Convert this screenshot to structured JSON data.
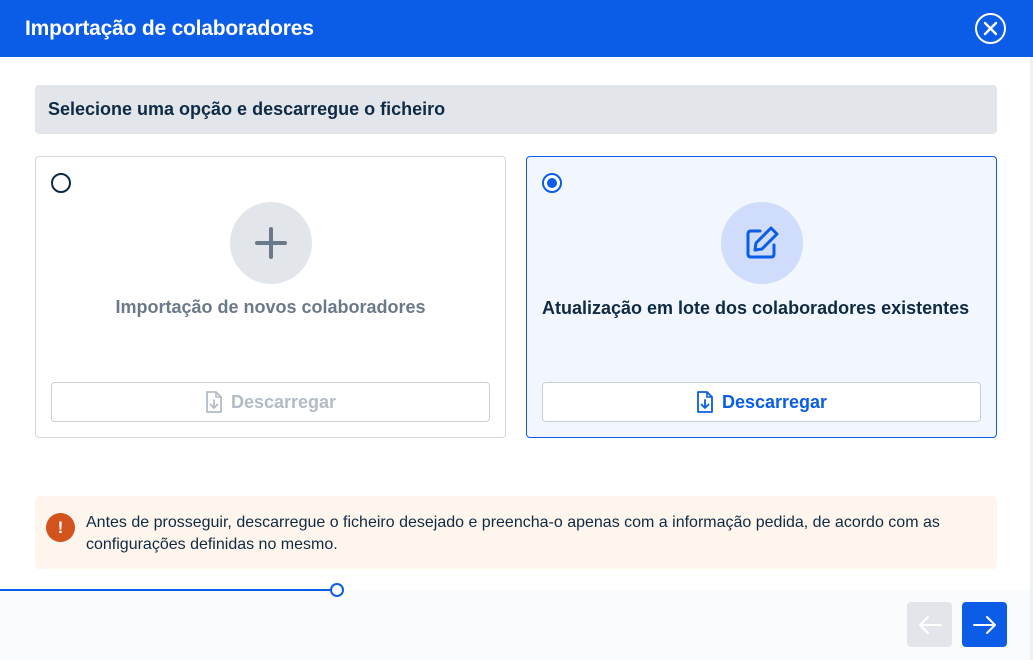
{
  "header": {
    "title": "Importação de colaboradores"
  },
  "section": {
    "title": "Selecione uma opção e descarregue o ficheiro"
  },
  "options": [
    {
      "title": "Importação de novos colaboradores",
      "download_label": "Descarregar",
      "selected": false,
      "icon": "plus-icon"
    },
    {
      "title": "Atualização em lote dos colaboradores existentes",
      "download_label": "Descarregar",
      "selected": true,
      "icon": "edit-icon"
    }
  ],
  "notice": {
    "text": "Antes de prosseguir, descarregue o ficheiro desejado e preencha-o apenas com a informação pedida, de acordo com as configurações definidas no mesmo.",
    "icon": "exclamation-icon"
  },
  "colors": {
    "primary": "#0b5ce6",
    "warning": "#d2541c",
    "notice_bg": "#fef5ec",
    "section_bg": "#e2e6eb"
  }
}
